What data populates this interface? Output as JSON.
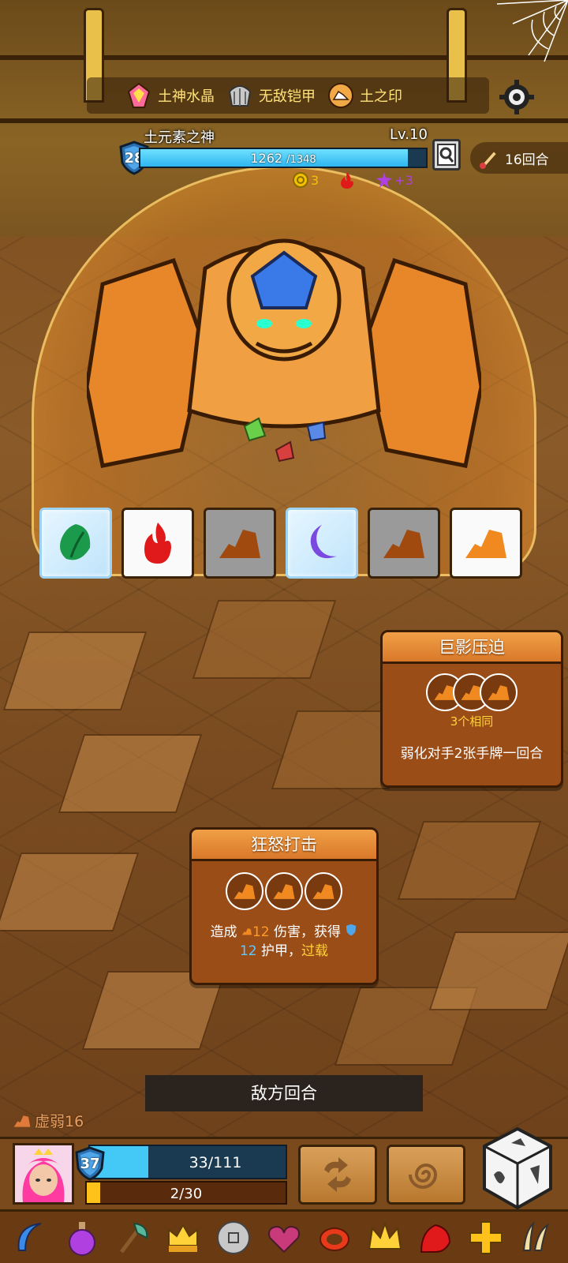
{
  "header": {
    "artifacts": [
      {
        "label": "土神水晶",
        "icon": "crystal-icon"
      },
      {
        "label": "无敌铠甲",
        "icon": "armor-icon"
      },
      {
        "label": "土之印",
        "icon": "earth-seal-icon"
      }
    ],
    "settings_icon": "gear-icon"
  },
  "boss": {
    "name": "土元素之神",
    "level": "Lv.10",
    "shield": "28",
    "hp": "1262",
    "hp_max": "/1348",
    "hp_fraction": 0.936,
    "statuses": [
      {
        "icon": "coin-icon",
        "value": "3",
        "color": "#f2c200"
      },
      {
        "icon": "fire-icon",
        "value": "",
        "color": "#e01a1a"
      },
      {
        "icon": "star-icon",
        "value": "+3",
        "color": "#b040e0"
      }
    ]
  },
  "round": {
    "label": "16回合",
    "icon": "scroll-icon"
  },
  "dice_slots": [
    {
      "icon": "leaf-icon",
      "state": "frozen",
      "color": "#1a9a4a"
    },
    {
      "icon": "fire-icon",
      "state": "white",
      "color": "#e01a1a"
    },
    {
      "icon": "rock-icon",
      "state": "gray",
      "color": "#a04a10"
    },
    {
      "icon": "moon-icon",
      "state": "frozen",
      "color": "#7a4ae0"
    },
    {
      "icon": "rock-icon",
      "state": "gray",
      "color": "#a04a10"
    },
    {
      "icon": "rock-icon",
      "state": "white",
      "color": "#f08a20"
    }
  ],
  "skill_cards": [
    {
      "title": "巨影压迫",
      "requirement": "3个相同",
      "description": "弱化对手2张手牌一回合"
    },
    {
      "title": "狂怒打击",
      "desc_part1": "造成",
      "damage": "12",
      "desc_part2": "伤害，获得",
      "armor": "12",
      "desc_part3": "护甲，",
      "overload": "过载"
    }
  ],
  "turn_banner": "敌方回合",
  "player": {
    "weak_status": "虚弱16",
    "shield": "37",
    "hp": "33/111",
    "hp_fraction": 0.297,
    "energy": "2/30",
    "energy_fraction": 0.067
  },
  "items": [
    "boomerang-icon",
    "potion-icon",
    "axe-icon",
    "crown-helmet-icon",
    "coin-icon",
    "heart-icon",
    "ring-icon",
    "gold-crown-icon",
    "red-dragon-icon",
    "holy-cross-icon",
    "claws-icon"
  ]
}
